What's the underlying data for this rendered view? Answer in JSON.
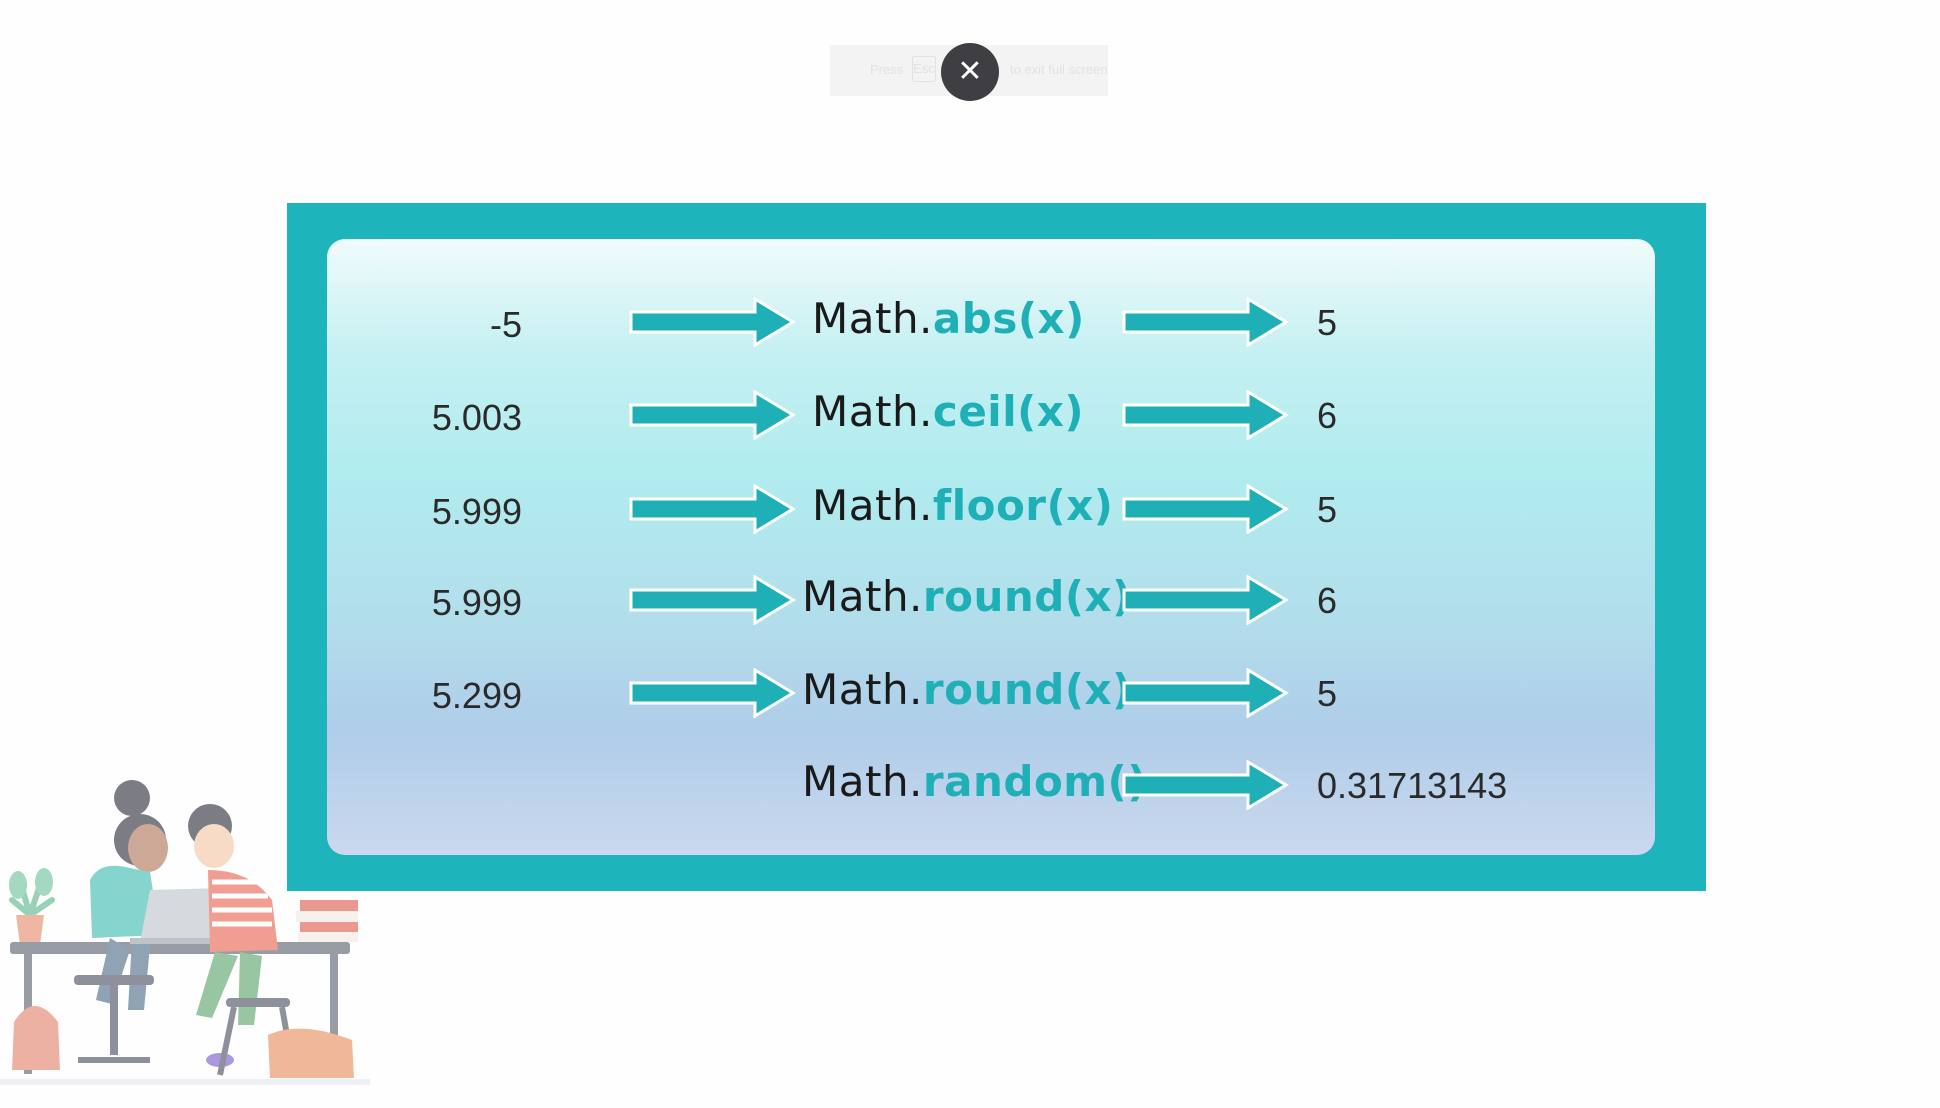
{
  "toast": {
    "text_before": "Press",
    "key": "Esc",
    "text_after": "to exit full screen"
  },
  "close_glyph": "✕",
  "colors": {
    "frame": "#1eb4bb",
    "method": "#1fb0b7",
    "arrow": "#1fb0b7"
  },
  "rows": [
    {
      "input": "-5",
      "object": "Math.",
      "method": "abs(x)",
      "output": "5"
    },
    {
      "input": "5.003",
      "object": "Math.",
      "method": "ceil(x)",
      "output": "6"
    },
    {
      "input": "5.999",
      "object": "Math.",
      "method": "floor(x)",
      "output": "5"
    },
    {
      "input": "5.999",
      "object": "Math.",
      "method": "round(x)",
      "output": "6"
    },
    {
      "input": "5.299",
      "object": "Math.",
      "method": "round(x)",
      "output": "5"
    },
    {
      "input": "",
      "object": "Math.",
      "method": "random()",
      "output": "0.31713143"
    }
  ]
}
